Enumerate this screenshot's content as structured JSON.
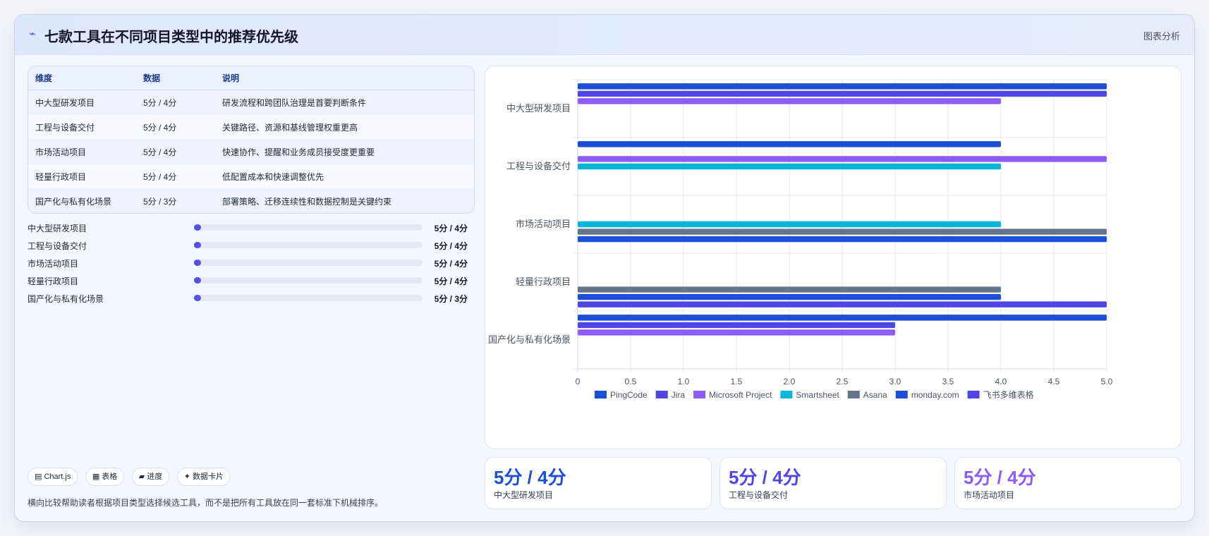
{
  "header": {
    "icon": "⌁",
    "title": "七款工具在不同项目类型中的推荐优先级",
    "tag": "图表分析"
  },
  "table": {
    "headers": [
      "维度",
      "数据",
      "说明"
    ],
    "rows": [
      [
        "中大型研发项目",
        "5分 / 4分",
        "研发流程和跨团队治理是首要判断条件"
      ],
      [
        "工程与设备交付",
        "5分 / 4分",
        "关键路径、资源和基线管理权重更高"
      ],
      [
        "市场活动项目",
        "5分 / 4分",
        "快速协作、提醒和业务成员接受度更重要"
      ],
      [
        "轻量行政项目",
        "5分 / 4分",
        "低配置成本和快速调整优先"
      ],
      [
        "国产化与私有化场景",
        "5分 / 3分",
        "部署策略、迁移连续性和数据控制是关键约束"
      ]
    ]
  },
  "progress": [
    {
      "label": "中大型研发项目",
      "value": "5分 / 4分",
      "fraction": 0.01
    },
    {
      "label": "工程与设备交付",
      "value": "5分 / 4分",
      "fraction": 0.01
    },
    {
      "label": "市场活动项目",
      "value": "5分 / 4分",
      "fraction": 0.01
    },
    {
      "label": "轻量行政项目",
      "value": "5分 / 4分",
      "fraction": 0.01
    },
    {
      "label": "国产化与私有化场景",
      "value": "5分 / 3分",
      "fraction": 0.01
    }
  ],
  "chips": [
    "▤ Chart.js",
    "▦ 表格",
    "▰ 进度",
    "✦ 数据卡片"
  ],
  "note": "横向比较帮助读者根据项目类型选择候选工具，而不是把所有工具放在同一套标准下机械排序。",
  "stats": [
    {
      "value": "5分 / 4分",
      "label": "中大型研发项目",
      "color": "#1d4ed8"
    },
    {
      "value": "5分 / 4分",
      "label": "工程与设备交付",
      "color": "#4f46e5"
    },
    {
      "value": "5分 / 4分",
      "label": "市场活动项目",
      "color": "#8b5cf6"
    }
  ],
  "chart_data": {
    "type": "bar",
    "orientation": "horizontal",
    "categories": [
      "中大型研发项目",
      "工程与设备交付",
      "市场活动项目",
      "轻量行政项目",
      "国产化与私有化场景"
    ],
    "series": [
      {
        "name": "PingCode",
        "color": "#1d4ed8",
        "values": [
          5,
          4,
          null,
          null,
          5
        ]
      },
      {
        "name": "Jira",
        "color": "#4f46e5",
        "values": [
          5,
          null,
          null,
          null,
          3
        ]
      },
      {
        "name": "Microsoft Project",
        "color": "#8b5cf6",
        "values": [
          4,
          5,
          null,
          null,
          3
        ]
      },
      {
        "name": "Smartsheet",
        "color": "#06b6d4",
        "values": [
          null,
          4,
          4,
          null,
          null
        ]
      },
      {
        "name": "Asana",
        "color": "#64748b",
        "values": [
          null,
          null,
          5,
          4,
          null
        ]
      },
      {
        "name": "monday.com",
        "color": "#1d4ed8",
        "values": [
          null,
          null,
          5,
          4,
          null
        ]
      },
      {
        "name": "飞书多维表格",
        "color": "#4f46e5",
        "values": [
          null,
          null,
          null,
          5,
          null
        ]
      }
    ],
    "xlim": [
      0,
      5
    ],
    "xticks": [
      "0",
      "0.5",
      "1.0",
      "1.5",
      "2.0",
      "2.5",
      "3.0",
      "3.5",
      "4.0",
      "4.5",
      "5.0"
    ],
    "grid": true,
    "legend_position": "bottom"
  }
}
